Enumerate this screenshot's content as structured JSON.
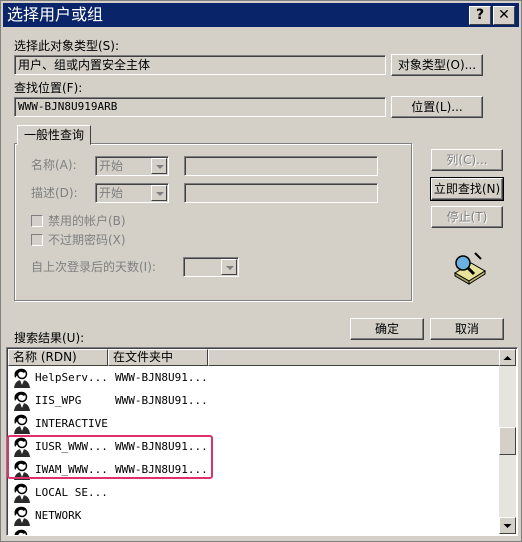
{
  "window": {
    "title": "选择用户或组",
    "help_btn": "?",
    "close_btn": "✕"
  },
  "object_type": {
    "label": "选择此对象类型(S):",
    "value": "用户、组或内置安全主体",
    "button": "对象类型(O)..."
  },
  "location": {
    "label": "查找位置(F):",
    "value": "WWW-BJN8U919ARB",
    "button": "位置(L)..."
  },
  "query": {
    "tab": "一般性查询",
    "name_label": "名称(A):",
    "name_mode": "开始",
    "desc_label": "描述(D):",
    "desc_mode": "开始",
    "disabled_accounts": "禁用的帐户(B)",
    "no_expire_pwd": "不过期密码(X)",
    "days_label": "自上次登录后的天数(I):"
  },
  "side_buttons": {
    "columns": "列(C)...",
    "find_now": "立即查找(N)",
    "stop": "停止(T)"
  },
  "ok_label": "确定",
  "cancel_label": "取消",
  "results": {
    "label": "搜索结果(U):",
    "columns": [
      "名称 (RDN)",
      "在文件夹中"
    ],
    "rows": [
      {
        "name": "HelpServ...",
        "folder": "WWW-BJN8U91..."
      },
      {
        "name": "IIS_WPG",
        "folder": "WWW-BJN8U91..."
      },
      {
        "name": "INTERACTIVE",
        "folder": ""
      },
      {
        "name": "IUSR_WWW...",
        "folder": "WWW-BJN8U91..."
      },
      {
        "name": "IWAM_WWW...",
        "folder": "WWW-BJN8U91..."
      },
      {
        "name": "LOCAL SE...",
        "folder": ""
      },
      {
        "name": "NETWORK",
        "folder": ""
      },
      {
        "name": "",
        "folder": ""
      }
    ]
  },
  "colors": {
    "title_bar": "#0a246a",
    "face": "#d4d0c8",
    "highlight_box": "#e0306a"
  }
}
